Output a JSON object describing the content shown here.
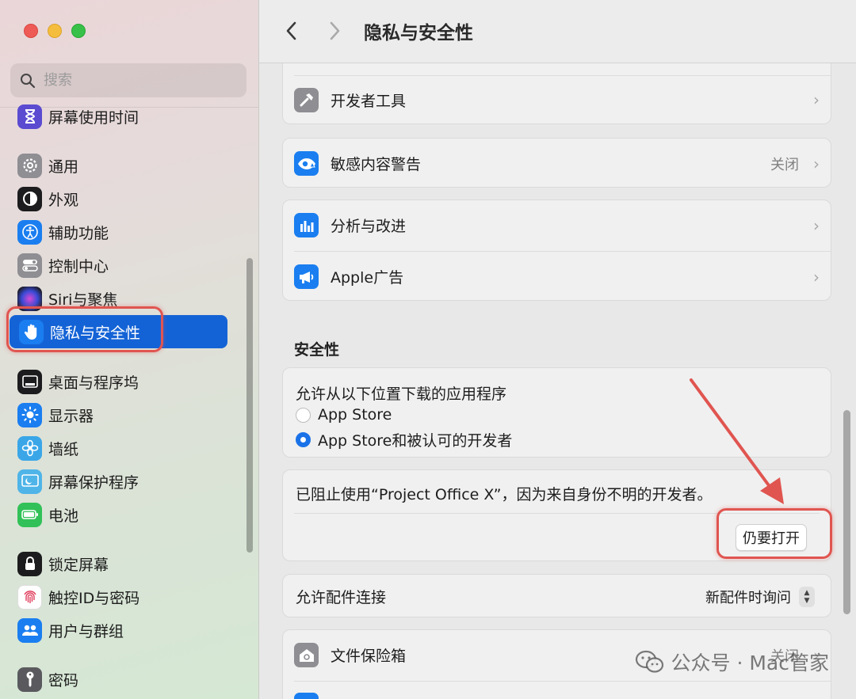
{
  "window": {
    "title": "隐私与安全性"
  },
  "search": {
    "placeholder": "搜索"
  },
  "sidebar": {
    "items": [
      {
        "label": "屏幕使用时间",
        "icon": "hourglass-icon",
        "color": "#5a4bd1"
      },
      {
        "label": "通用",
        "icon": "gear-icon",
        "color": "#8e8e93"
      },
      {
        "label": "外观",
        "icon": "appearance-icon",
        "color": "#1c1c1e"
      },
      {
        "label": "辅助功能",
        "icon": "accessibility-icon",
        "color": "#1a7ef0"
      },
      {
        "label": "控制中心",
        "icon": "toggles-icon",
        "color": "#8e8e93"
      },
      {
        "label": "Siri与聚焦",
        "icon": "siri-icon",
        "color": "#2c2c3a"
      },
      {
        "label": "隐私与安全性",
        "icon": "hand-icon",
        "color": "#1a7ef0"
      },
      {
        "label": "桌面与程序坞",
        "icon": "dock-icon",
        "color": "#1c1c1e"
      },
      {
        "label": "显示器",
        "icon": "sun-icon",
        "color": "#1a7ef0"
      },
      {
        "label": "墙纸",
        "icon": "flower-icon",
        "color": "#3aa6e8"
      },
      {
        "label": "屏幕保护程序",
        "icon": "screensaver-icon",
        "color": "#4fb4e8"
      },
      {
        "label": "电池",
        "icon": "battery-icon",
        "color": "#32c158"
      },
      {
        "label": "锁定屏幕",
        "icon": "lock-icon",
        "color": "#1c1c1e"
      },
      {
        "label": "触控ID与密码",
        "icon": "fingerprint-icon",
        "color": "#ffffff"
      },
      {
        "label": "用户与群组",
        "icon": "users-icon",
        "color": "#1a7ef0"
      },
      {
        "label": "密码",
        "icon": "key-icon",
        "color": "#5a5a5e"
      }
    ]
  },
  "main": {
    "rows": {
      "developer_tools": {
        "label": "开发者工具"
      },
      "sensitive_content": {
        "label": "敏感内容警告",
        "value": "关闭"
      },
      "analytics": {
        "label": "分析与改进"
      },
      "apple_ads": {
        "label": "Apple广告"
      }
    },
    "security": {
      "title": "安全性",
      "allow_label": "允许从以下位置下载的应用程序",
      "options": [
        "App Store",
        "App Store和被认可的开发者"
      ],
      "selected": "App Store和被认可的开发者",
      "blocked_message": "已阻止使用“Project Office X”，因为来自身份不明的开发者。",
      "open_anyway_label": "仍要打开",
      "accessories_label": "允许配件连接",
      "accessories_value": "新配件时询问",
      "filevault_label": "文件保险箱",
      "filevault_value": "关闭"
    }
  },
  "watermark": {
    "text": "公众号 · Mac管家"
  },
  "colors": {
    "accent": "#1463d6",
    "annotation": "#e05550"
  }
}
